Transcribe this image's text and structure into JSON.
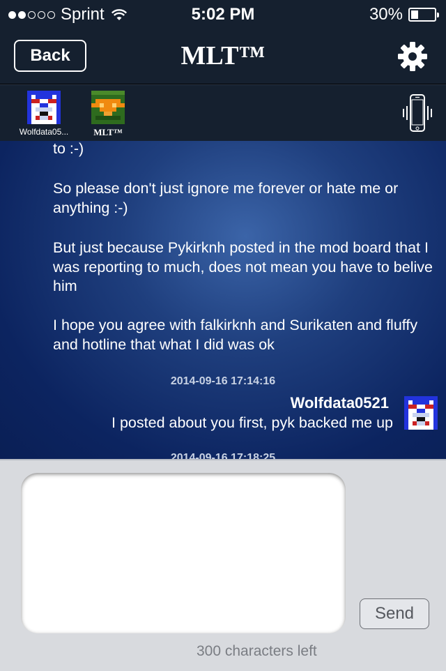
{
  "status_bar": {
    "carrier": "Sprint",
    "time": "5:02 PM",
    "battery": "30%",
    "battery_level": 0.3,
    "signal_bars_filled": 2,
    "signal_bars_total": 5
  },
  "nav": {
    "back_label": "Back",
    "title": "MLT™",
    "settings_icon": "gear-icon"
  },
  "avatars": [
    {
      "label": "Wolfdata05..."
    },
    {
      "label": "MLT™"
    }
  ],
  "vibrate_icon": "phone-vibrate-icon",
  "chat": {
    "partial_line": "to :-)",
    "paragraphs": [
      "So please don't just ignore me forever or hate me or anything :-)",
      "But just because Pykirknh posted in the mod board that I was reporting to much, does not mean you have to belive him",
      "I hope you agree with falkirknh and Surikaten and fluffy and hotline that what I did was ok"
    ],
    "messages": [
      {
        "timestamp": "2014-09-16 17:14:16",
        "sender": "Wolfdata0521",
        "text": "I posted about you first, pyk backed me up"
      },
      {
        "timestamp": "2014-09-16 17:18:25"
      }
    ]
  },
  "compose": {
    "input_value": "",
    "send_label": "Send",
    "chars_left": "300 characters left"
  },
  "colors": {
    "bar_bg": "#15202f",
    "chat_gradient": "#1f3f7e",
    "compose_bg": "#d8dade"
  }
}
